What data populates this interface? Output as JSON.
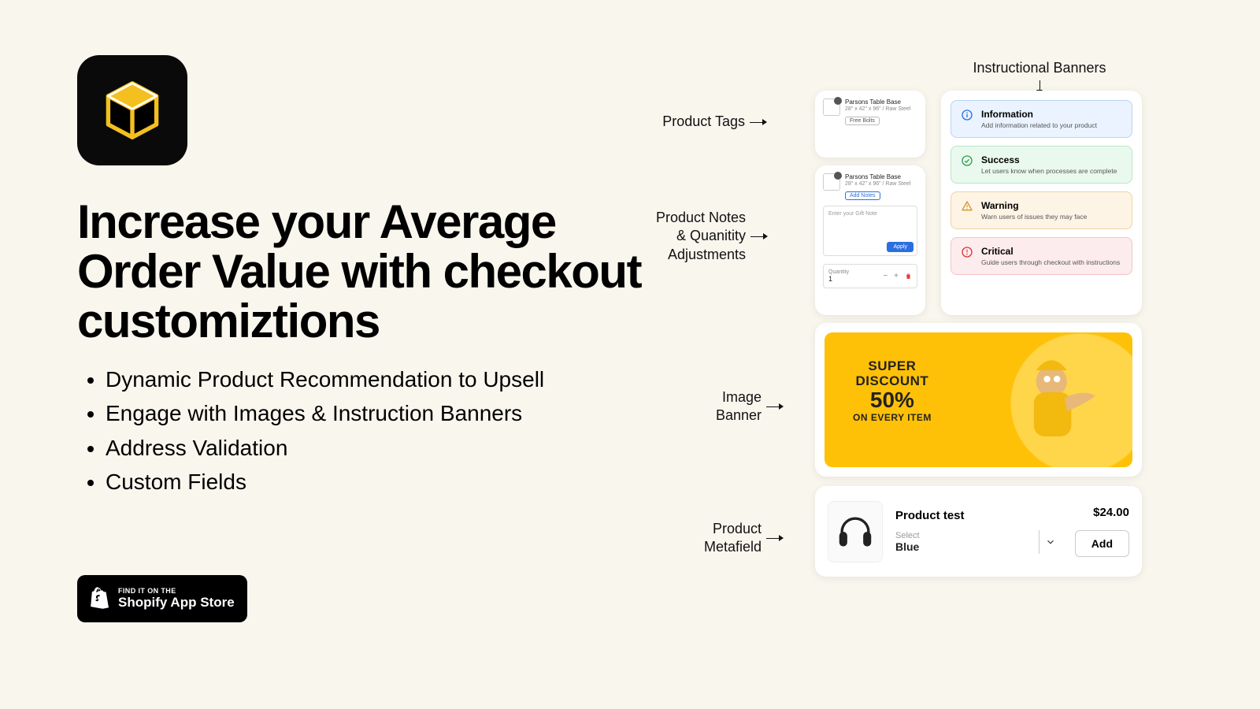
{
  "headline": "Increase your Average Order Value with checkout customiztions",
  "bullets": [
    "Dynamic Product Recommendation to Upsell",
    "Engage with Images & Instruction Banners",
    "Address Validation",
    "Custom Fields"
  ],
  "appstore": {
    "line1": "FIND IT ON THE",
    "line2": "Shopify App Store"
  },
  "labels": {
    "tags": "Product Tags",
    "notes_l1": "Product Notes",
    "notes_l2": "& Quanitity",
    "notes_l3": "Adjustments",
    "banners": "Instructional Banners",
    "image": "Image",
    "image2": "Banner",
    "meta": "Product",
    "meta2": "Metafield"
  },
  "mini": {
    "name": "Parsons Table Base",
    "variant": "28\" x 42\" x 96\" / Raw Steel",
    "tag": "Free Bolts",
    "note_link": "Add Notes",
    "gift_placeholder": "Enter your Gift Note",
    "apply": "Apply",
    "qty_label": "Quantity",
    "qty_value": "1"
  },
  "banners": {
    "info": {
      "t": "Information",
      "d": "Add information related to your product"
    },
    "succ": {
      "t": "Success",
      "d": "Let users know when processes are complete"
    },
    "warn": {
      "t": "Warning",
      "d": "Warn users of issues they may face"
    },
    "crit": {
      "t": "Critical",
      "d": "Guide users through checkout with instructions"
    }
  },
  "promo": {
    "p1": "SUPER",
    "p2": "DISCOUNT",
    "p3": "50%",
    "p4": "ON EVERY ITEM"
  },
  "meta": {
    "name": "Product test",
    "price": "$24.00",
    "select_label": "Select",
    "select_value": "Blue",
    "add": "Add"
  }
}
